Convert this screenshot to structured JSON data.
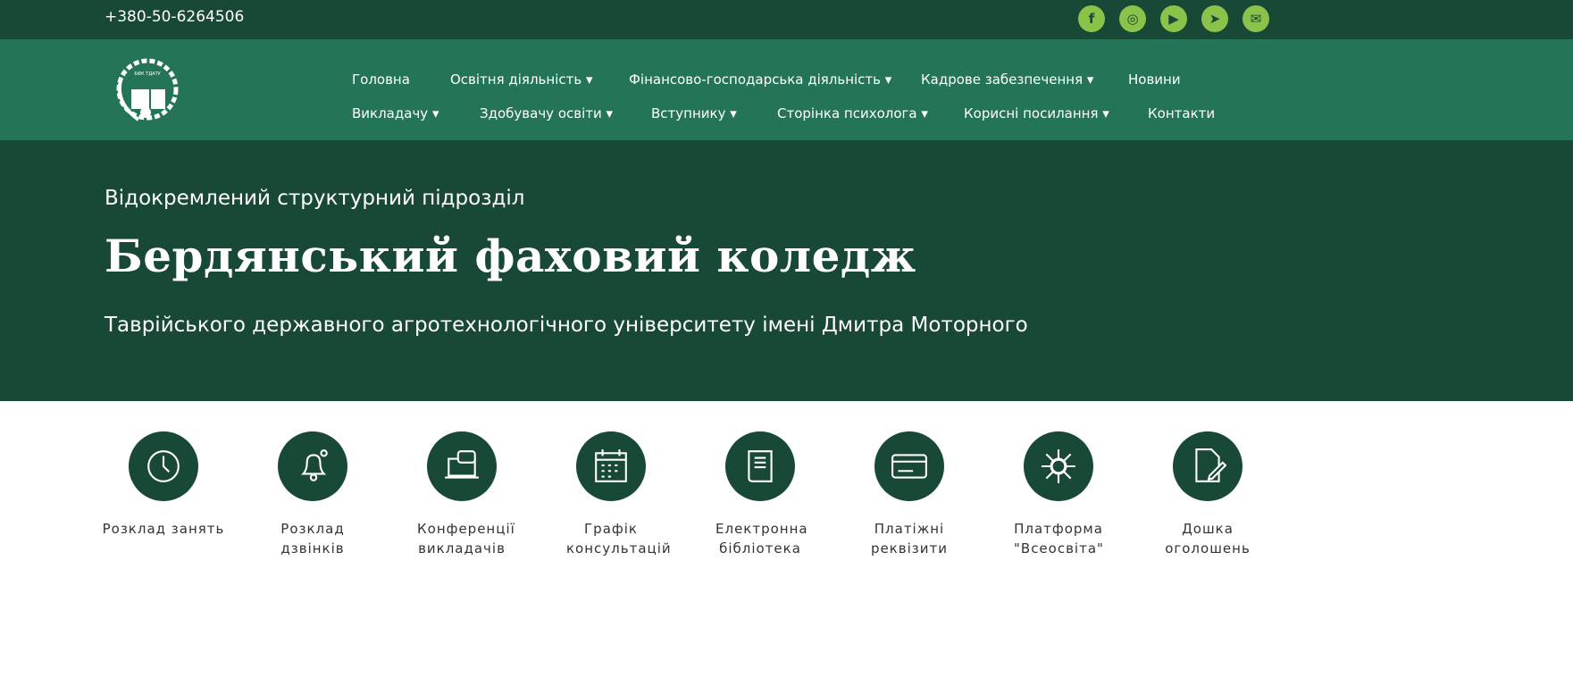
{
  "topbar": {
    "phone": "+380-50-6264506",
    "social": [
      "facebook-icon",
      "instagram-icon",
      "youtube-icon",
      "telegram-icon",
      "email-icon"
    ]
  },
  "logo": {
    "text": "БЕРДЯНСЬКИЙ ФАХОВИЙ КОЛЕДЖ ТДАТУ"
  },
  "menu": {
    "row1": [
      {
        "label": "Головна",
        "dd": false
      },
      {
        "label": "Освітня діяльність",
        "dd": true
      },
      {
        "label": "Фінансово-господарська діяльність",
        "dd": true
      },
      {
        "label": "Кадрове забезпечення",
        "dd": true
      },
      {
        "label": "Новини",
        "dd": false
      }
    ],
    "row2": [
      {
        "label": "Викладачу",
        "dd": true
      },
      {
        "label": "Здобувачу освіти",
        "dd": true
      },
      {
        "label": "Вступнику",
        "dd": true
      },
      {
        "label": "Сторінка психолога",
        "dd": true
      },
      {
        "label": "Корисні посилання",
        "dd": true
      },
      {
        "label": "Контакти",
        "dd": false
      }
    ]
  },
  "hero": {
    "subtitle": "Відокремлений структурний підрозділ",
    "title": "Бердянський фаховий коледж",
    "tagline": "Таврійського державного агротехнологічного університету імені Дмитра Моторного"
  },
  "tiles": [
    {
      "label": "Розклад занять",
      "icon": "clock-icon"
    },
    {
      "label": "Розклад дзвінків",
      "icon": "bell-icon"
    },
    {
      "label": "Конференції викладачів",
      "icon": "laptop-chat-icon"
    },
    {
      "label": "Графік консультацій",
      "icon": "calendar-icon"
    },
    {
      "label": "Електронна бібліотека",
      "icon": "book-icon"
    },
    {
      "label": "Платіжні реквізити",
      "icon": "credit-card-icon"
    },
    {
      "label": "Платформа \"Всеосвіта\"",
      "icon": "snowflake-icon"
    },
    {
      "label": "Дошка оголошень",
      "icon": "document-edit-icon"
    }
  ]
}
